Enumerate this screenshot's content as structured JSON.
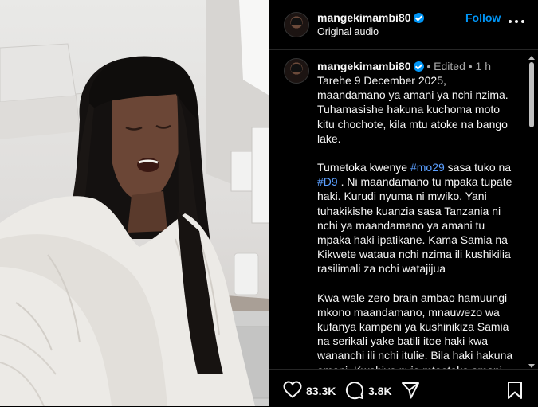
{
  "post": {
    "username": "mangekimambi80",
    "audio": "Original audio",
    "follow_label": "Follow"
  },
  "caption": {
    "username": "mangekimambi80",
    "meta": " • Edited • 1 h",
    "p1": "Tarehe 9 December 2025, maandamano ya amani ya nchi nzima. Tuhamasishe hakuna kuchoma moto kitu chochote, kila mtu atoke na bango lake.",
    "p2_a": "Tumetoka kwenye ",
    "hashtag1": "#mo29",
    "p2_b": " sasa tuko na ",
    "hashtag2": "#D9",
    "p2_c": " . Ni maandamano tu mpaka tupate haki. Kurudi nyuma ni mwiko. Yani tuhakikishe kuanzia sasa Tanzania ni nchi ya maandamano ya amani tu mpaka haki ipatikane. Kama Samia na Kikwete  wataua nchi nzima ili kushikilia rasilimali za nchi watajijua",
    "p3": "Kwa wale zero brain ambao hamuungi mkono maandamano, mnauwezo wa kufanya kampeni ya kushinikiza Samia na serikali yake batili itoe haki kwa wananchi ili nchi itulie. Bila haki hakuna amani. Kwahiyo nyie mtaotaka amani yooote hata amani feki basi wakalieni"
  },
  "actions": {
    "likes": "83.3K",
    "comments": "3.8K"
  },
  "icons": {
    "verified": "verified-badge-icon",
    "more": "more-options-icon",
    "like": "heart-icon",
    "comment": "comment-bubble-icon",
    "share": "share-paper-plane-icon",
    "save": "bookmark-icon"
  },
  "colors": {
    "background": "#000000",
    "link_blue": "#0095f6",
    "hashtag": "#5b9fff",
    "muted": "#a8a8a8"
  }
}
